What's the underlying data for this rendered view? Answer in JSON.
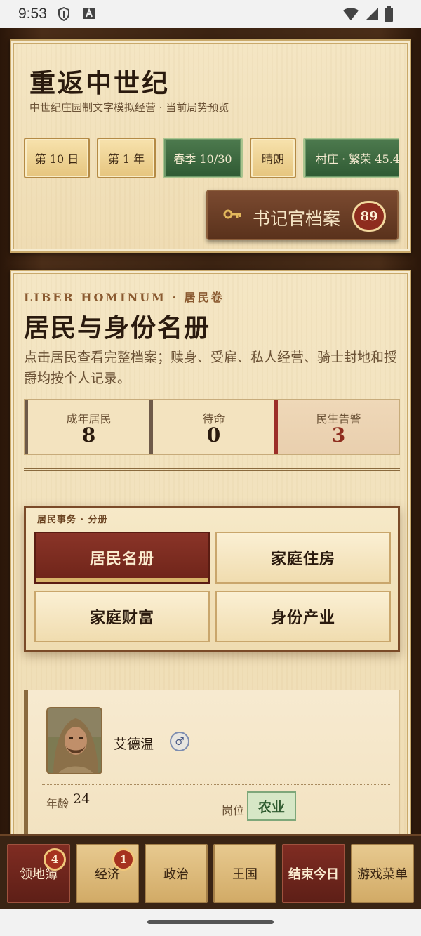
{
  "status_bar": {
    "time": "9:53"
  },
  "header": {
    "title": "重返中世纪",
    "subtitle": "中世纪庄园制文字模拟经营 · 当前局势预览",
    "chips": [
      "第 10 日",
      "第 1 年",
      "春季 10/30",
      "晴朗",
      "村庄 · 繁荣 45.4"
    ],
    "archive_button": {
      "label": "书记官档案",
      "count": "89",
      "icon": "key-icon"
    }
  },
  "residents": {
    "kicker": "LIBER HOMINUM · 居民卷",
    "title": "居民与身份名册",
    "description": "点击居民查看完整档案；赎身、受雇、私人经营、骑士封地和授爵均按个人记录。",
    "stats": [
      {
        "label": "成年居民",
        "value": "8"
      },
      {
        "label": "待命",
        "value": "0"
      },
      {
        "label": "民生告警",
        "value": "3"
      }
    ],
    "subsection": {
      "caption": "居民事务 · 分册",
      "tabs": [
        "居民名册",
        "家庭住房",
        "家庭财富",
        "身份产业"
      ],
      "active_tab": "居民名册"
    },
    "card": {
      "name": "艾德温",
      "gender_symbol": "♂",
      "age_label": "年龄",
      "age": "24",
      "job_label": "岗位",
      "job": "农业"
    }
  },
  "bottom_nav": {
    "items": [
      {
        "label": "领地簿",
        "badge": "4"
      },
      {
        "label": "经济",
        "badge": "1"
      },
      {
        "label": "政治"
      },
      {
        "label": "王国"
      },
      {
        "label": "结束今日"
      },
      {
        "label": "游戏菜单"
      }
    ]
  },
  "colors": {
    "accent_red": "#8e2c1e",
    "accent_green": "#2f5a33",
    "parchment": "#f4e6c4",
    "wood": "#3a2414"
  }
}
